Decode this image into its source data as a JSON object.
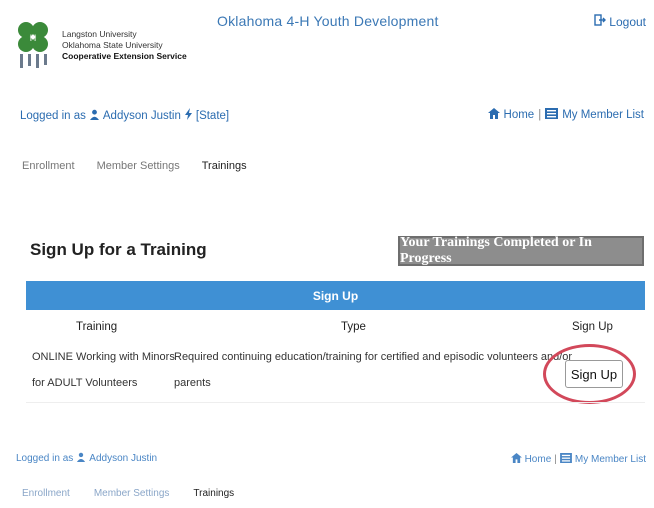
{
  "header": {
    "app_title": "Oklahoma 4-H Youth Development",
    "logout_label": "Logout",
    "institutions": [
      "Langston University",
      "Oklahoma State University",
      "Cooperative Extension Service"
    ]
  },
  "user_bar": {
    "prefix": "Logged in as",
    "name": "Addyson Justin",
    "role": "[State]",
    "home_label": "Home",
    "separator": "|",
    "member_list_label": "My Member List"
  },
  "tabs": [
    "Enrollment",
    "Member Settings",
    "Trainings"
  ],
  "active_tab": "Trainings",
  "section": {
    "title": "Sign Up for a Training",
    "completed_button": "Your Trainings Completed or In Progress"
  },
  "panel": {
    "header": "Sign Up",
    "columns": [
      "Training",
      "Type",
      "Sign Up"
    ],
    "rows": [
      {
        "training_line1": "ONLINE Working with Minors",
        "training_line2": "for ADULT Volunteers",
        "type_line1": "Required continuing education/training for certified and episodic volunteers and/or",
        "type_line2": "parents",
        "action": "Sign Up"
      }
    ]
  },
  "footer_bar": {
    "prefix": "Logged in as",
    "name": "Addyson Justin",
    "home_label": "Home",
    "separator": "|",
    "member_list_label": "My Member List",
    "tabs": [
      "Enrollment",
      "Member Settings",
      "Trainings"
    ]
  },
  "colors": {
    "link": "#2b6cb0",
    "panel_header": "#3f90d4",
    "completed_button": "#8d8d8d",
    "highlight_circle": "#d2485a"
  },
  "icons": {
    "logout": "logout-icon",
    "user": "user-icon",
    "role": "lightning-icon",
    "home": "home-icon",
    "list": "list-icon",
    "logo": "4h-clover-logo"
  }
}
